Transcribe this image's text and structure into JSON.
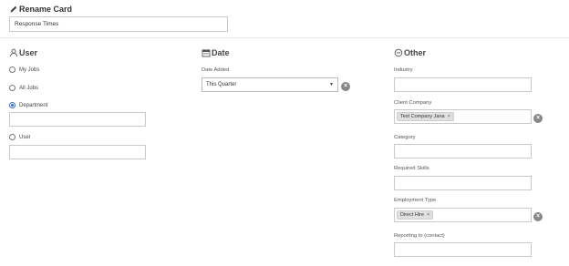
{
  "rename": {
    "title": "Rename Card",
    "value": "Response Times"
  },
  "user": {
    "title": "User",
    "options": [
      {
        "label": "My Jobs",
        "checked": false
      },
      {
        "label": "All Jobs",
        "checked": false
      },
      {
        "label": "Department",
        "checked": true
      },
      {
        "label": "User",
        "checked": false
      }
    ]
  },
  "date": {
    "title": "Date",
    "date_added_label": "Date Added",
    "date_added_value": "This Quarter"
  },
  "other": {
    "title": "Other",
    "industry_label": "Industry",
    "client_company_label": "Client Company",
    "client_company_tag": "Test Company Jana",
    "category_label": "Category",
    "required_skills_label": "Required Skills",
    "employment_type_label": "Employment Type",
    "employment_type_tag": "Direct Hire",
    "reporting_to_label": "Reporting to (contact)"
  },
  "icons": {
    "tag_remove": "×",
    "clear": "×",
    "dropdown": "▼"
  },
  "colors": {
    "radio_selected": "#3a6fc4",
    "clear_button": "#888888"
  }
}
